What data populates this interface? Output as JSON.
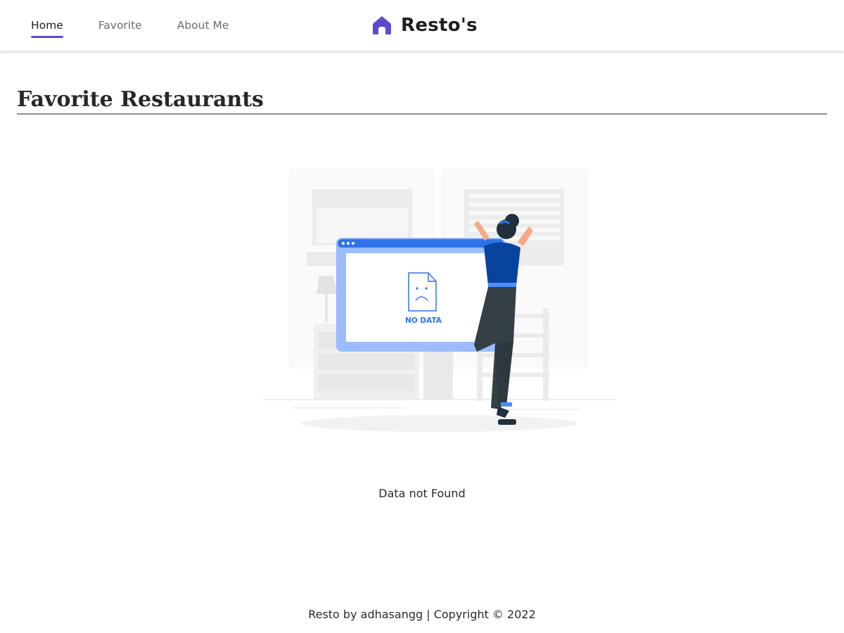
{
  "header": {
    "nav": [
      {
        "label": "Home",
        "active": true
      },
      {
        "label": "Favorite",
        "active": false
      },
      {
        "label": "About Me",
        "active": false
      }
    ],
    "brand_title": "Resto's",
    "brand_icon": "home-icon",
    "accent_color": "#5b4ccf"
  },
  "main": {
    "page_title": "Favorite Restaurants",
    "illustration": {
      "icon": "sad-document-icon",
      "label": "NO DATA"
    },
    "empty_message": "Data not Found"
  },
  "footer": {
    "text": "Resto by adhasangg | Copyright © 2022"
  }
}
